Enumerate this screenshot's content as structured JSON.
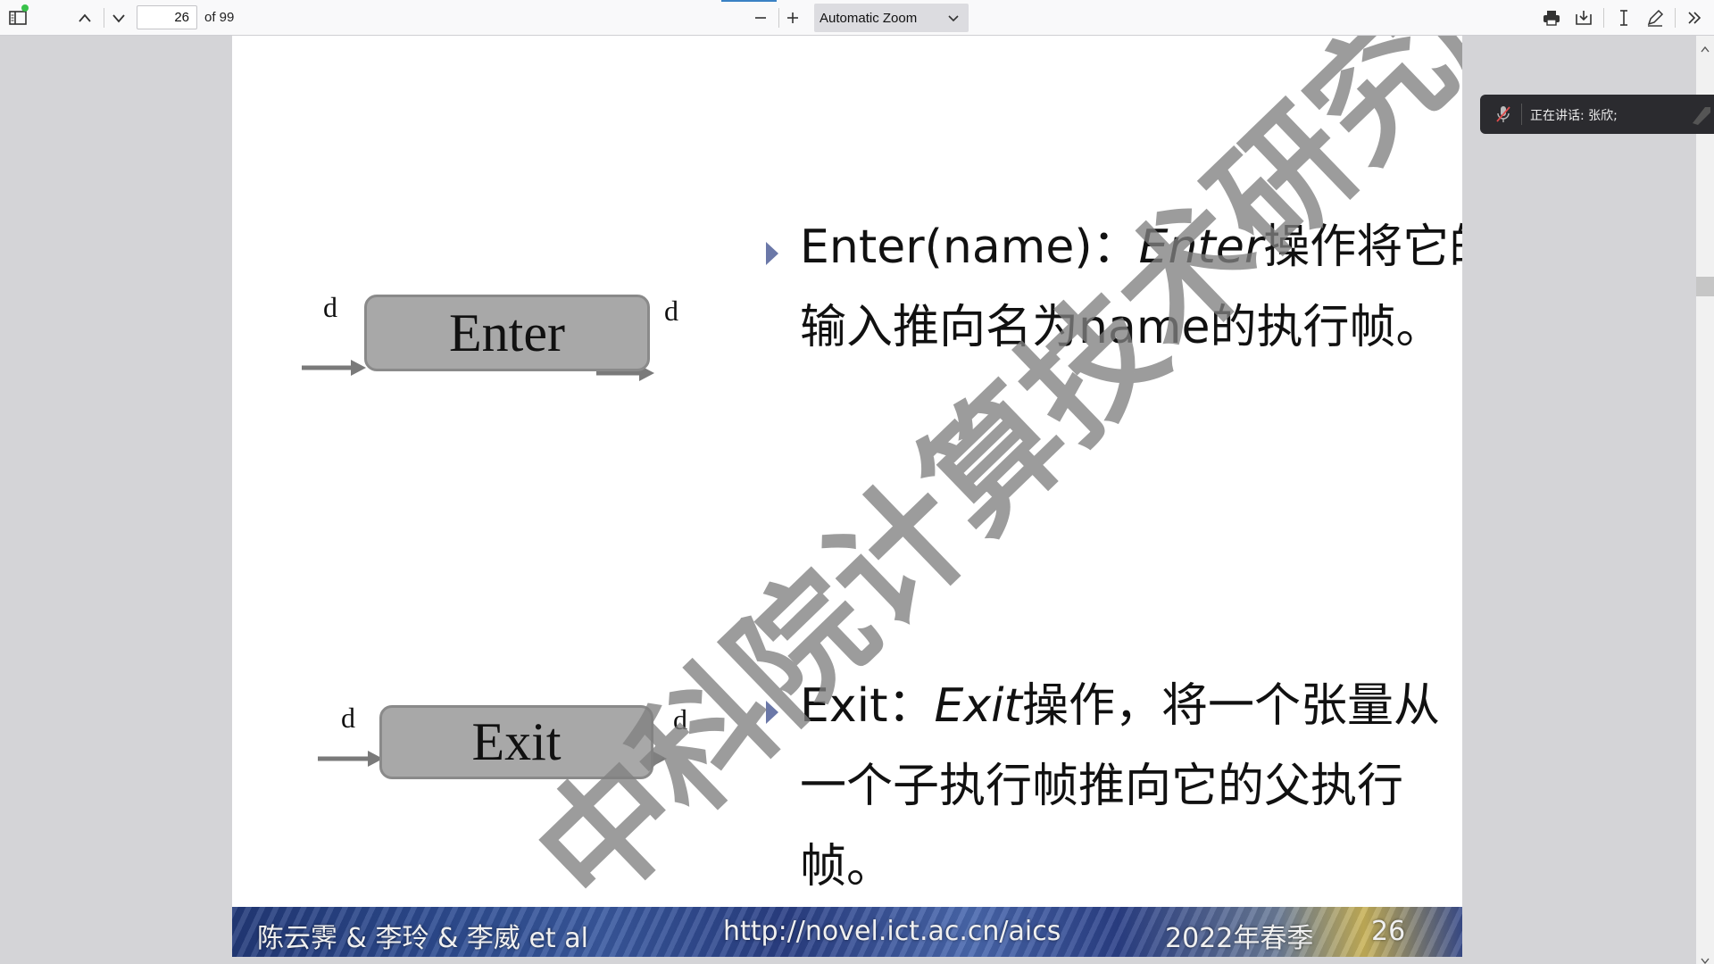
{
  "toolbar": {
    "page_number": "26",
    "page_count": "of 99",
    "zoom_label": "Automatic Zoom"
  },
  "slide": {
    "enter_box_label": "Enter",
    "exit_box_label": "Exit",
    "arrow_label": "d",
    "enter_heading": "Enter(name)",
    "enter_sep": "：",
    "enter_italic": "Enter",
    "enter_rest_line1": "操作将它的",
    "enter_line2": "输入推向名为name的执行帧。",
    "exit_heading": "Exit",
    "exit_sep": "：",
    "exit_italic": "Exit",
    "exit_rest_line1": "操作，将一个张量从",
    "exit_line2": "一个子执行帧推向它的父执行",
    "exit_line3": "帧。",
    "watermark": "中科院计算技术研究所",
    "bullet_color": "#6b78a8"
  },
  "footer": {
    "authors": "陈云霁 & 李玲 & 李威 et al",
    "url": "http://novel.ict.ac.cn/aics",
    "term": "2022年春季",
    "page": "26"
  },
  "speaking_popup": {
    "text": "正在讲话: 张欣;"
  }
}
